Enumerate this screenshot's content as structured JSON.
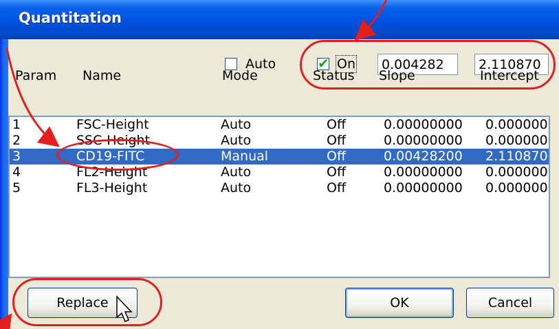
{
  "window": {
    "title": "Quantitation"
  },
  "controls": {
    "auto_label": "Auto",
    "auto_checked": false,
    "on_label": "On",
    "on_checked": true,
    "slope_value": "0.004282",
    "intercept_value": "2.110870"
  },
  "columns": [
    "Param",
    "Name",
    "Mode",
    "Status",
    "Slope",
    "Intercept"
  ],
  "rows": [
    {
      "param": "1",
      "name": "FSC-Height",
      "mode": "Auto",
      "status": "Off",
      "slope": "0.00000000",
      "intercept": "0.0000000"
    },
    {
      "param": "2",
      "name": "SSC-Height",
      "mode": "Auto",
      "status": "Off",
      "slope": "0.00000000",
      "intercept": "0.0000000"
    },
    {
      "param": "3",
      "name": "CD19-FITC",
      "mode": "Manual",
      "status": "Off",
      "slope": "0.00428200",
      "intercept": "2.1108700"
    },
    {
      "param": "4",
      "name": "FL2-Height",
      "mode": "Auto",
      "status": "Off",
      "slope": "0.00000000",
      "intercept": "0.0000000"
    },
    {
      "param": "5",
      "name": "FL3-Height",
      "mode": "Auto",
      "status": "Off",
      "slope": "0.00000000",
      "intercept": "0.0000000"
    }
  ],
  "selected_row": 3,
  "buttons": {
    "replace": "Replace",
    "ok": "OK",
    "cancel": "Cancel"
  },
  "colors": {
    "selection": "#316AC5",
    "annotation": "#E21F1F",
    "titlebar": "#0054E3"
  }
}
